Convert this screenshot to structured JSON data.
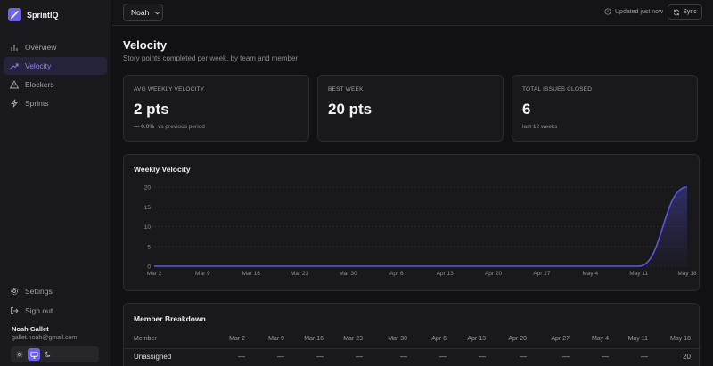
{
  "app": {
    "name": "SprintIQ"
  },
  "sidebar": {
    "items": [
      {
        "label": "Overview",
        "icon": "bar-chart-icon",
        "active": false
      },
      {
        "label": "Velocity",
        "icon": "trending-up-icon",
        "active": true
      },
      {
        "label": "Blockers",
        "icon": "warning-icon",
        "active": false
      },
      {
        "label": "Sprints",
        "icon": "lightning-icon",
        "active": false
      }
    ],
    "bottom": [
      {
        "label": "Settings",
        "icon": "gear-icon"
      },
      {
        "label": "Sign out",
        "icon": "logout-icon"
      }
    ],
    "user": {
      "name": "Noah Gallet",
      "email": "gallet.noah@gmail.com"
    },
    "theme": {
      "options": [
        "sun-icon",
        "monitor-icon",
        "moon-icon"
      ],
      "selected": "monitor-icon"
    }
  },
  "header": {
    "member_select": "Noah",
    "updated": "Updated just now",
    "sync_label": "Sync"
  },
  "page": {
    "title": "Velocity",
    "subtitle": "Story points completed per week, by team and member"
  },
  "cards": [
    {
      "label": "AVG WEEKLY VELOCITY",
      "value": "2 pts",
      "delta": "— 0.0%",
      "note": "vs previous period"
    },
    {
      "label": "BEST WEEK",
      "value": "20 pts",
      "delta": "",
      "note": ""
    },
    {
      "label": "TOTAL ISSUES CLOSED",
      "value": "6",
      "delta": "",
      "note": "last 12 weeks"
    }
  ],
  "chart_data": {
    "type": "area",
    "title": "Weekly Velocity",
    "categories": [
      "Mar 2",
      "Mar 9",
      "Mar 16",
      "Mar 23",
      "Mar 30",
      "Apr 6",
      "Apr 13",
      "Apr 20",
      "Apr 27",
      "May 4",
      "May 11",
      "May 18"
    ],
    "series": [
      {
        "values": [
          0,
          0,
          0,
          0,
          0,
          0,
          0,
          0,
          0,
          0,
          0,
          20
        ]
      }
    ],
    "yticks": [
      0,
      5,
      10,
      15,
      20
    ],
    "ylim": [
      0,
      20
    ],
    "grid": true,
    "color": "#5b55e6"
  },
  "table": {
    "title": "Member Breakdown",
    "member_header": "Member",
    "columns": [
      "Mar 2",
      "Mar 9",
      "Mar 16",
      "Mar 23",
      "Mar 30",
      "Apr 6",
      "Apr 13",
      "Apr 20",
      "Apr 27",
      "May 4",
      "May 11",
      "May 18"
    ],
    "rows": [
      {
        "member": "Unassigned",
        "values": [
          "—",
          "—",
          "—",
          "—",
          "—",
          "—",
          "—",
          "—",
          "—",
          "—",
          "—",
          "20"
        ]
      }
    ]
  }
}
